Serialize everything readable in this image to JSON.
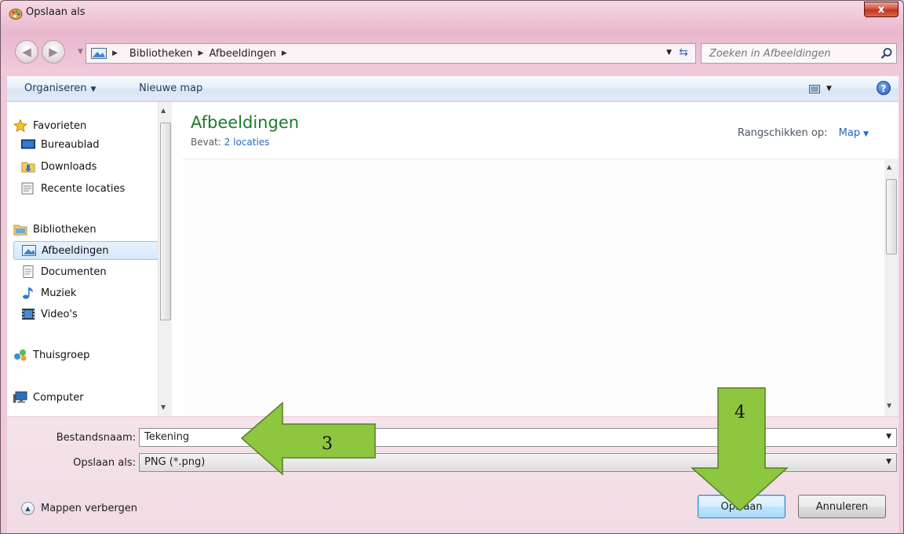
{
  "window": {
    "title": "Opslaan als",
    "close_label": "x"
  },
  "address": {
    "crumbs": [
      "Bibliotheken",
      "Afbeeldingen"
    ]
  },
  "search": {
    "placeholder": "Zoeken in Afbeeldingen"
  },
  "command_bar": {
    "organise": "Organiseren",
    "new_folder": "Nieuwe map"
  },
  "nav": {
    "favorites": "Favorieten",
    "desktop": "Bureaublad",
    "downloads": "Downloads",
    "recent": "Recente locaties",
    "libraries": "Bibliotheken",
    "pictures": "Afbeeldingen",
    "documents": "Documenten",
    "music": "Muziek",
    "videos": "Video's",
    "homegroup": "Thuisgroep",
    "computer": "Computer"
  },
  "content": {
    "title": "Afbeeldingen",
    "contains_label": "Bevat:",
    "contains_value": "2 locaties",
    "arrange_label": "Rangschikken op:",
    "arrange_value": "Map"
  },
  "form": {
    "filename_label": "Bestandsnaam:",
    "filename_value": "Tekening",
    "savetype_label": "Opslaan als:",
    "savetype_value": "PNG (*.png)",
    "hide_folders": "Mappen verbergen",
    "save_button": "Opslaan",
    "cancel_button": "Annuleren"
  },
  "annotations": {
    "step3": "3",
    "step4": "4",
    "arrow_color": "#8dc63f"
  }
}
